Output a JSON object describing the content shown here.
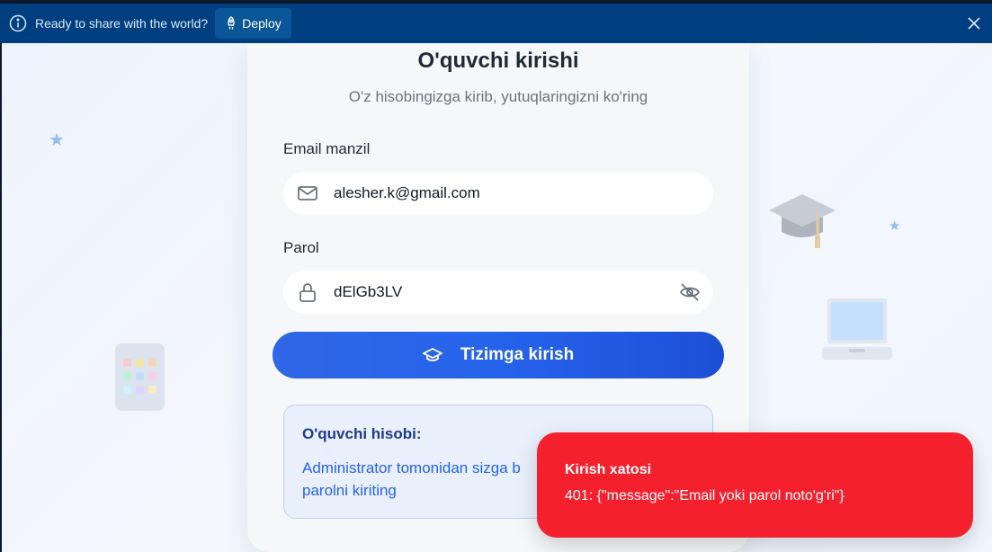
{
  "banner": {
    "message": "Ready to share with the world?",
    "deploy_label": "Deploy",
    "icons": {
      "info": "info-icon",
      "deploy": "rocket-icon",
      "close": "close-icon"
    }
  },
  "login": {
    "title": "O'quvchi kirishi",
    "subtitle": "O'z hisobingizga kirib, yutuqlaringizni ko'ring",
    "email_label": "Email manzil",
    "email_value": "alesher.k@gmail.com",
    "password_label": "Parol",
    "password_value": "dElGb3LV",
    "submit_label": "Tizimga kirish",
    "icons": {
      "email": "mail-icon",
      "password": "lock-icon",
      "toggle": "eye-off-icon",
      "submit": "graduation-cap-icon"
    }
  },
  "info_box": {
    "title": "O'quvchi hisobi:",
    "text_line1": "Administrator tomonidan sizga b",
    "text_line2": "parolni kiriting"
  },
  "toast": {
    "title": "Kirish xatosi",
    "message": "401: {\"message\":\"Email yoki parol noto'g'ri\"}"
  },
  "decorations": [
    "star-icon",
    "star-icon",
    "graduation-cap-icon",
    "laptop-icon",
    "tablet-icon"
  ],
  "colors": {
    "banner_bg": "#003f7f",
    "deploy_bg": "#0b5599",
    "primary": "#2563eb",
    "toast_bg": "#f4202e",
    "card_bg": "#f5f7f8"
  }
}
